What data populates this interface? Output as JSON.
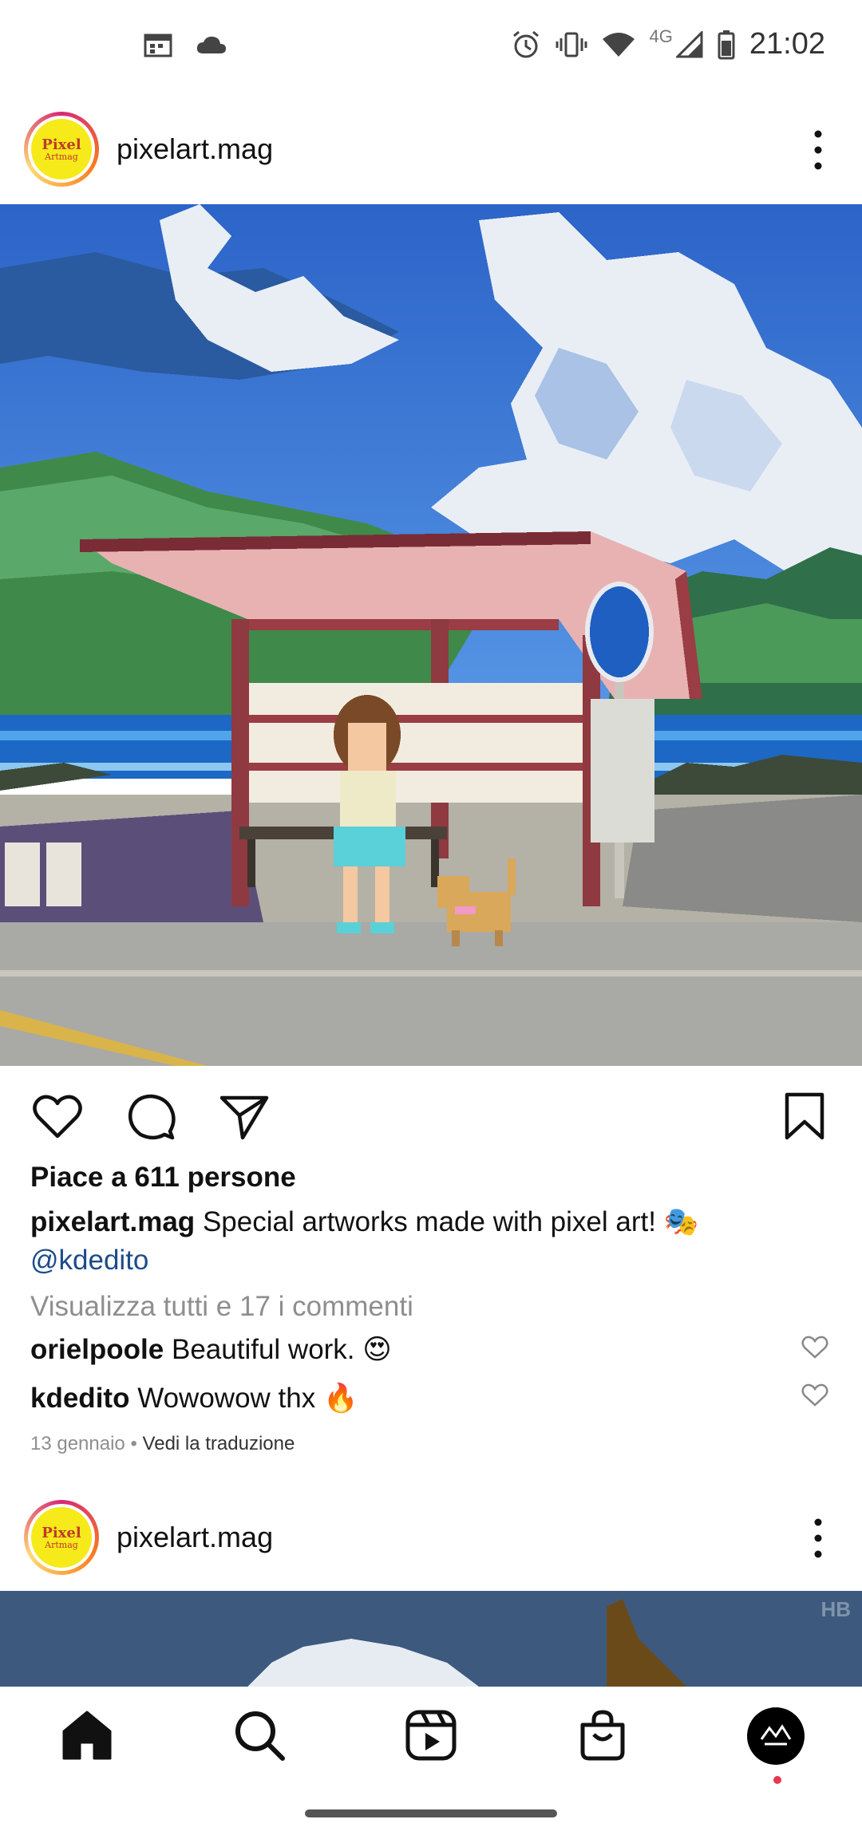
{
  "status": {
    "time": "21:02",
    "network": "4G"
  },
  "post1": {
    "username": "pixelart.mag",
    "avatar_text_1": "Pixel",
    "avatar_text_2": "Artmag",
    "likes": "Piace a 611 persone",
    "caption_user": "pixelart.mag",
    "caption_text": "Special artworks made with pixel art! 🎭",
    "caption_mention": "@kdedito",
    "view_comments": "Visualizza tutti e 17 i commenti",
    "comments": [
      {
        "user": "orielpoole",
        "text": "Beautiful work. 😍"
      },
      {
        "user": "kdedito",
        "text": "Wowowow thx 🔥"
      }
    ],
    "date": "13 gennaio",
    "separator": "•",
    "translate": "Vedi la traduzione"
  },
  "post2": {
    "username": "pixelart.mag",
    "avatar_text_1": "Pixel",
    "avatar_text_2": "Artmag",
    "watermark": "HB"
  },
  "colors": {
    "accent_link": "#1d4b8a",
    "notification_dot": "#e63950"
  }
}
